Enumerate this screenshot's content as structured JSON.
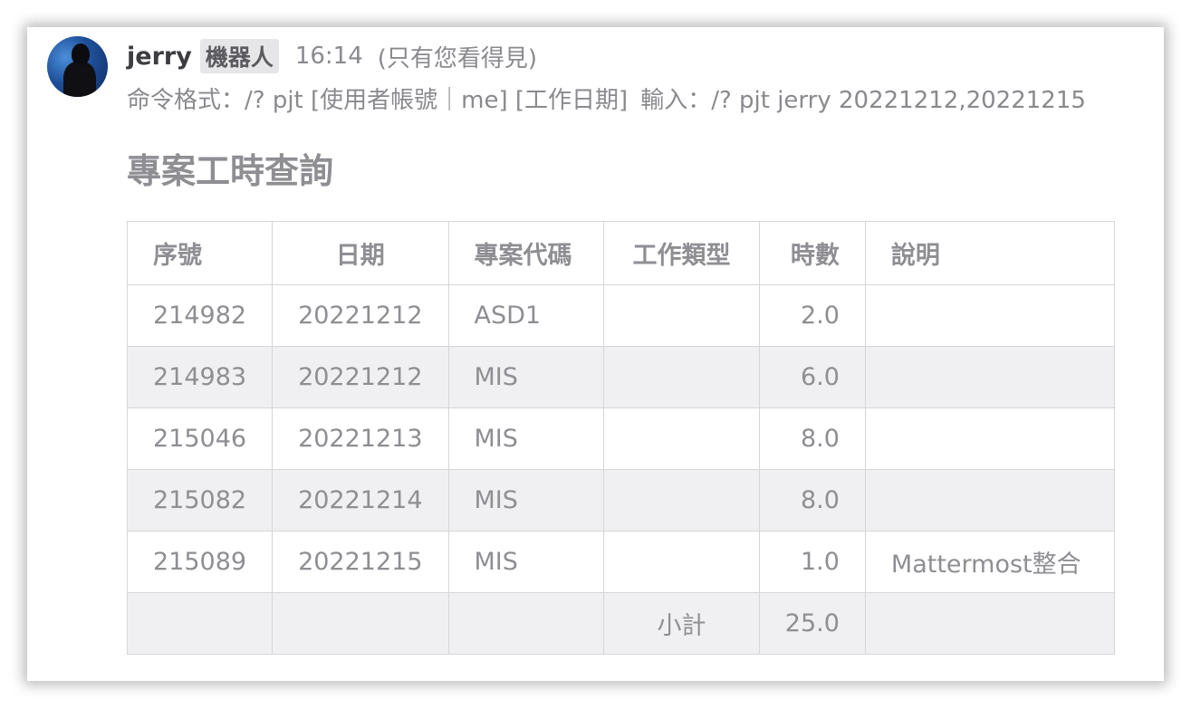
{
  "post": {
    "username": "jerry",
    "bot_tag": "機器人",
    "timestamp": "16:14",
    "visibility": "(只有您看得見)",
    "command_format": "命令格式：/? pjt [使用者帳號｜me] [工作日期]",
    "command_example": "輸入：/? pjt jerry 20221212,20221215"
  },
  "report": {
    "title": "專案工時查詢",
    "columns": [
      "序號",
      "日期",
      "專案代碼",
      "工作類型",
      "時數",
      "說明"
    ],
    "rows": [
      {
        "seq": "214982",
        "date": "20221212",
        "project": "ASD1",
        "type": "",
        "hours": "2.0",
        "desc": ""
      },
      {
        "seq": "214983",
        "date": "20221212",
        "project": "MIS",
        "type": "",
        "hours": "6.0",
        "desc": ""
      },
      {
        "seq": "215046",
        "date": "20221213",
        "project": "MIS",
        "type": "",
        "hours": "8.0",
        "desc": ""
      },
      {
        "seq": "215082",
        "date": "20221214",
        "project": "MIS",
        "type": "",
        "hours": "8.0",
        "desc": ""
      },
      {
        "seq": "215089",
        "date": "20221215",
        "project": "MIS",
        "type": "",
        "hours": "1.0",
        "desc": "Mattermost整合"
      }
    ],
    "subtotal_label": "小計",
    "subtotal_value": "25.0"
  }
}
